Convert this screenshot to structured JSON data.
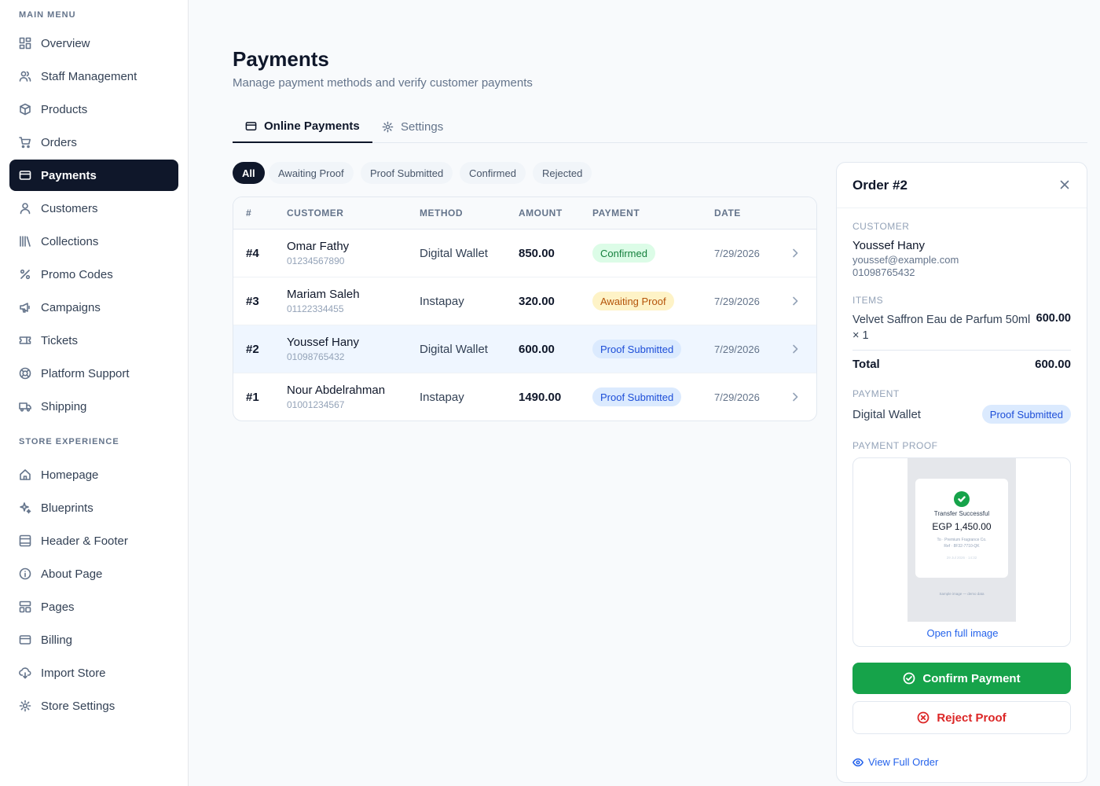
{
  "sidebar": {
    "main_menu_label": "MAIN MENU",
    "store_experience_label": "STORE EXPERIENCE",
    "main_items": [
      {
        "label": "Overview",
        "icon": "grid-icon"
      },
      {
        "label": "Staff Management",
        "icon": "users-icon"
      },
      {
        "label": "Products",
        "icon": "box-icon"
      },
      {
        "label": "Orders",
        "icon": "cart-icon"
      },
      {
        "label": "Payments",
        "icon": "credit-card-icon",
        "active": true
      },
      {
        "label": "Customers",
        "icon": "user-icon"
      },
      {
        "label": "Collections",
        "icon": "library-icon"
      },
      {
        "label": "Promo Codes",
        "icon": "percent-icon"
      },
      {
        "label": "Campaigns",
        "icon": "megaphone-icon"
      },
      {
        "label": "Tickets",
        "icon": "ticket-icon"
      },
      {
        "label": "Platform Support",
        "icon": "lifebuoy-icon"
      },
      {
        "label": "Shipping",
        "icon": "truck-icon"
      }
    ],
    "store_items": [
      {
        "label": "Homepage",
        "icon": "home-icon"
      },
      {
        "label": "Blueprints",
        "icon": "sparkles-icon"
      },
      {
        "label": "Header & Footer",
        "icon": "layout-icon"
      },
      {
        "label": "About Page",
        "icon": "info-icon"
      },
      {
        "label": "Pages",
        "icon": "pages-icon"
      },
      {
        "label": "Billing",
        "icon": "billing-card-icon"
      },
      {
        "label": "Import Store",
        "icon": "cloud-download-icon"
      },
      {
        "label": "Store Settings",
        "icon": "gear-icon"
      }
    ]
  },
  "header": {
    "title": "Payments",
    "subtitle": "Manage payment methods and verify customer payments"
  },
  "tabs": [
    {
      "label": "Online Payments",
      "icon": "credit-card-icon",
      "active": true
    },
    {
      "label": "Settings",
      "icon": "gear-icon",
      "active": false
    }
  ],
  "filters": [
    {
      "label": "All",
      "active": true
    },
    {
      "label": "Awaiting Proof",
      "active": false
    },
    {
      "label": "Proof Submitted",
      "active": false
    },
    {
      "label": "Confirmed",
      "active": false
    },
    {
      "label": "Rejected",
      "active": false
    }
  ],
  "table": {
    "columns": [
      "#",
      "CUSTOMER",
      "METHOD",
      "AMOUNT",
      "PAYMENT",
      "DATE"
    ],
    "rows": [
      {
        "id": "#4",
        "name": "Omar Fathy",
        "phone": "01234567890",
        "method": "Digital Wallet",
        "amount": "850.00",
        "status": "Confirmed",
        "status_type": "confirmed",
        "date": "7/29/2026"
      },
      {
        "id": "#3",
        "name": "Mariam Saleh",
        "phone": "01122334455",
        "method": "Instapay",
        "amount": "320.00",
        "status": "Awaiting Proof",
        "status_type": "awaiting",
        "date": "7/29/2026"
      },
      {
        "id": "#2",
        "name": "Youssef Hany",
        "phone": "01098765432",
        "method": "Digital Wallet",
        "amount": "600.00",
        "status": "Proof Submitted",
        "status_type": "submitted",
        "date": "7/29/2026",
        "selected": true
      },
      {
        "id": "#1",
        "name": "Nour Abdelrahman",
        "phone": "01001234567",
        "method": "Instapay",
        "amount": "1490.00",
        "status": "Proof Submitted",
        "status_type": "submitted",
        "date": "7/29/2026"
      }
    ]
  },
  "panel": {
    "title": "Order #2",
    "customer_label": "CUSTOMER",
    "customer_name": "Youssef Hany",
    "customer_email": "youssef@example.com",
    "customer_phone": "01098765432",
    "items_label": "ITEMS",
    "item_name": "Velvet Saffron Eau de Parfum 50ml × 1",
    "item_price": "600.00",
    "total_label": "Total",
    "total_value": "600.00",
    "payment_label": "PAYMENT",
    "payment_method": "Digital Wallet",
    "payment_status": "Proof Submitted",
    "proof_label": "PAYMENT PROOF",
    "receipt": {
      "title": "Transfer Successful",
      "amount": "EGP 1,450.00",
      "to": "To · Premium Fragrance Co.",
      "ref": "Ref · 8F32-7710-QK",
      "date": "29 Jul 2026 · 14:32",
      "footer": "Sample image — demo data"
    },
    "open_full_image": "Open full image",
    "confirm_label": "Confirm Payment",
    "reject_label": "Reject Proof",
    "view_full_order": "View Full Order"
  },
  "colors": {
    "accent": "#0f172a",
    "confirm": "#16a34a",
    "reject": "#dc2626",
    "link": "#2563eb"
  }
}
